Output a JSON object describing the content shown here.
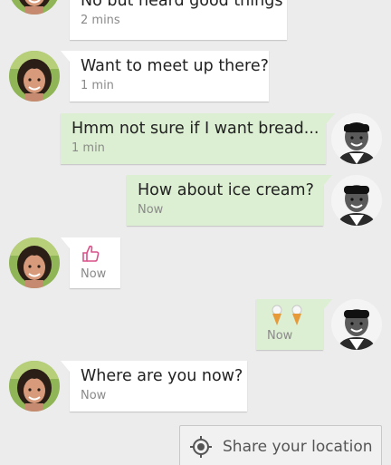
{
  "conversation": {
    "messages": [
      {
        "direction": "incoming",
        "text": "No but heard good things",
        "time": "2 mins"
      },
      {
        "direction": "incoming",
        "text": "Want to meet up there?",
        "time": "1 min"
      },
      {
        "direction": "outgoing",
        "text": "Hmm not sure if I want bread...",
        "time": "1 min"
      },
      {
        "direction": "outgoing",
        "text": "How about ice cream?",
        "time": "Now"
      },
      {
        "direction": "incoming",
        "sticker": "thumbs-up",
        "time": "Now"
      },
      {
        "direction": "outgoing",
        "sticker": "ice-cream-cones",
        "time": "Now"
      },
      {
        "direction": "incoming",
        "text": "Where are you now?",
        "time": "Now"
      }
    ]
  },
  "actions": {
    "share_location_label": "Share your location",
    "share_location_icon": "location-crosshair-icon"
  },
  "colors": {
    "background": "#ececec",
    "incoming_bubble": "#ffffff",
    "outgoing_bubble": "#dcefd2",
    "time_text": "#8a8a8a",
    "thumbs_icon": "#d9528a",
    "ice_cream_cone": "#e79a3a"
  }
}
